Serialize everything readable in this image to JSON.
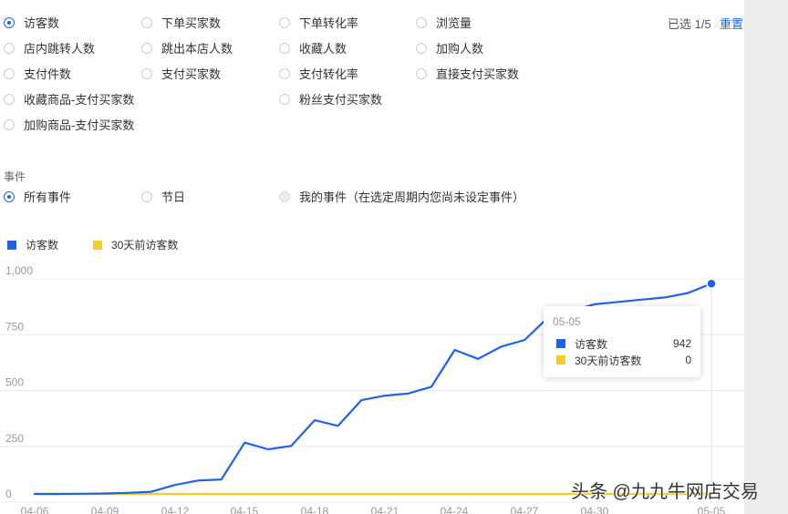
{
  "metrics": {
    "rows": [
      [
        {
          "label": "访客数",
          "checked": true
        },
        {
          "label": "下单买家数"
        },
        {
          "label": "下单转化率"
        },
        {
          "label": "浏览量"
        }
      ],
      [
        {
          "label": "店内跳转人数"
        },
        {
          "label": "跳出本店人数"
        },
        {
          "label": "收藏人数"
        },
        {
          "label": "加购人数"
        }
      ],
      [
        {
          "label": "支付件数"
        },
        {
          "label": "支付买家数"
        },
        {
          "label": "支付转化率"
        },
        {
          "label": "直接支付买家数"
        }
      ],
      [
        {
          "label": "收藏商品-支付买家数"
        },
        null,
        {
          "label": "粉丝支付买家数"
        },
        null
      ],
      [
        {
          "label": "加购商品-支付买家数"
        },
        null,
        null,
        null
      ]
    ],
    "selected_info": "已选 1/5",
    "reset_label": "重置"
  },
  "events": {
    "section_label": "事件",
    "options": [
      {
        "label": "所有事件",
        "checked": true
      },
      {
        "label": "节日"
      },
      {
        "label": "我的事件（在选定周期内您尚未设定事件）",
        "disabled": true
      }
    ]
  },
  "chart_data": {
    "type": "line",
    "legend": [
      {
        "name": "访客数",
        "color": "#2062e6"
      },
      {
        "name": "30天前访客数",
        "color": "#f5cc2a"
      }
    ],
    "y_ticks": [
      "1,000",
      "750",
      "500",
      "250",
      "0"
    ],
    "ylim": [
      0,
      1000
    ],
    "x_tick_labels": [
      "04-06",
      "04-09",
      "04-12",
      "04-15",
      "04-18",
      "04-21",
      "04-24",
      "04-27",
      "04-30",
      "05-05"
    ],
    "series": [
      {
        "name": "访客数",
        "color": "#2062e6",
        "values": [
          0,
          0,
          1,
          2,
          5,
          10,
          40,
          60,
          65,
          230,
          200,
          215,
          330,
          305,
          420,
          440,
          450,
          480,
          645,
          605,
          660,
          690,
          790,
          820,
          850,
          860,
          870,
          880,
          900,
          942
        ]
      },
      {
        "name": "30天前访客数",
        "color": "#f5cc2a",
        "values": [
          0,
          0,
          0,
          0,
          0,
          0,
          0,
          0,
          0,
          0,
          0,
          0,
          0,
          0,
          0,
          0,
          0,
          0,
          0,
          0,
          0,
          0,
          0,
          0,
          0,
          0,
          0,
          0,
          0,
          0
        ]
      }
    ]
  },
  "tooltip": {
    "date": "05-05",
    "rows": [
      {
        "name": "访客数",
        "value": "942",
        "color": "#2062e6"
      },
      {
        "name": "30天前访客数",
        "value": "0",
        "color": "#f5cc2a"
      }
    ]
  },
  "watermark": "头条 @九九牛网店交易"
}
